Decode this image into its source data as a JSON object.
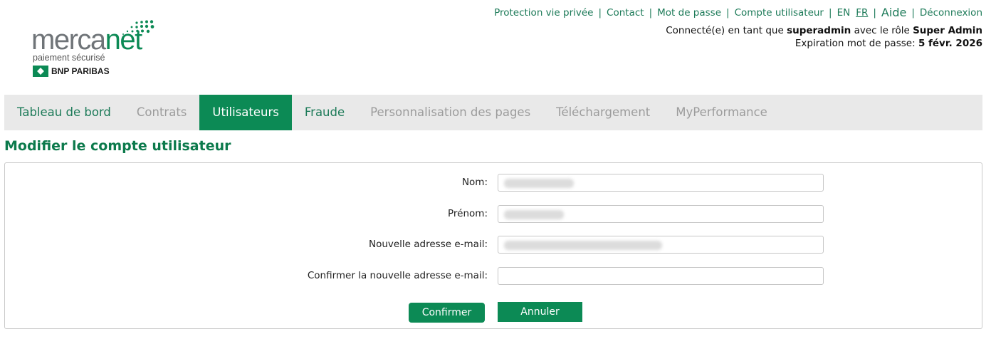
{
  "brand": {
    "word_left": "merca",
    "word_right": "net",
    "tagline": "paiement sécurisé",
    "bank": "BNP PARIBAS",
    "accent_color": "#0c8a55"
  },
  "top_links": {
    "privacy": "Protection vie privée",
    "contact": "Contact",
    "password": "Mot de passe",
    "account": "Compte utilisateur",
    "lang_en": "EN",
    "lang_fr": "FR",
    "help": "Aide",
    "logout": "Déconnexion",
    "separator": "|"
  },
  "session": {
    "prefix": "Connecté(e) en tant que",
    "username": "superadmin",
    "role_prefix": "avec le rôle",
    "role": "Super Admin",
    "expiry_label": "Expiration mot de passe:",
    "expiry_date": "5 févr. 2026"
  },
  "nav": {
    "items": [
      {
        "label": "Tableau de bord"
      },
      {
        "label": "Contrats"
      },
      {
        "label": "Utilisateurs"
      },
      {
        "label": "Fraude"
      },
      {
        "label": "Personnalisation des pages"
      },
      {
        "label": "Téléchargement"
      },
      {
        "label": "MyPerformance"
      }
    ],
    "active": "Utilisateurs"
  },
  "page": {
    "title": "Modifier le compte utilisateur"
  },
  "form": {
    "last_name_label": "Nom:",
    "first_name_label": "Prénom:",
    "new_email_label": "Nouvelle adresse e-mail:",
    "confirm_email_label": "Confirmer la nouvelle adresse e-mail:",
    "confirm_email_value": "",
    "confirm_button": "Confirmer",
    "cancel_button": "Annuler"
  }
}
